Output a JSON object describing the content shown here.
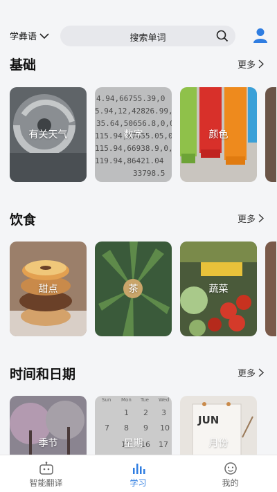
{
  "header": {
    "language": "学彝语",
    "search_placeholder": "搜索单词"
  },
  "sections": [
    {
      "title": "基础",
      "more": "更多",
      "cards": [
        "有关天气",
        "数字",
        "颜色"
      ]
    },
    {
      "title": "饮食",
      "more": "更多",
      "cards": [
        "甜点",
        "茶",
        "蔬菜"
      ]
    },
    {
      "title": "时间和日期",
      "more": "更多",
      "cards": [
        "季节",
        "星期",
        "月份"
      ]
    }
  ],
  "number_card_lines": [
    "4.94,66755.39,0",
    "5.94,12,42826.99,0,",
    "35.64,50656.8,0,0",
    "115.94,67655.05,0",
    "115.94,66938.9,0,0",
    "119.94,86421.04",
    "33798.5"
  ],
  "calendar_card": {
    "weekdays": [
      "Sun",
      "Mon",
      "Tue",
      "Wed"
    ],
    "numbers": [
      "1",
      "2",
      "3",
      "7",
      "8",
      "9",
      "10",
      "15",
      "16",
      "17"
    ]
  },
  "month_card_text": "JUN",
  "tabbar": {
    "items": [
      {
        "label": "智能翻译",
        "icon": "robot-icon",
        "active": false
      },
      {
        "label": "学习",
        "icon": "bar-chart-icon",
        "active": true
      },
      {
        "label": "我的",
        "icon": "user-face-icon",
        "active": false
      }
    ]
  },
  "colors": {
    "accent": "#2f7de1",
    "background": "#f4f5f7",
    "inactive_tab": "#666666"
  }
}
